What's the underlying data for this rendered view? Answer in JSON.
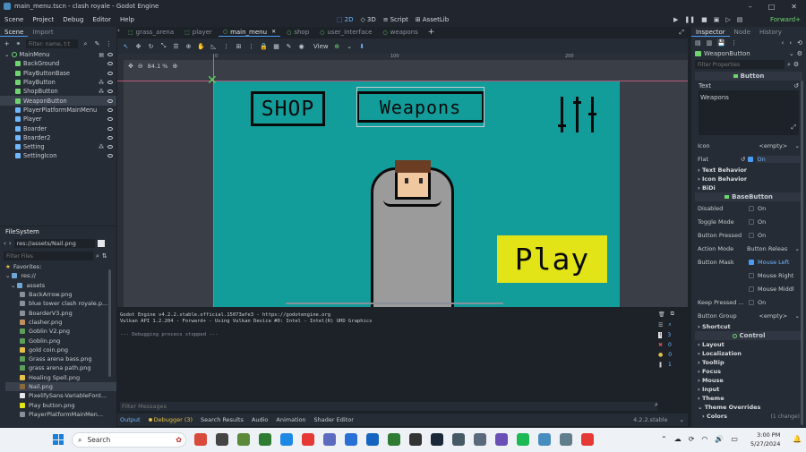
{
  "window": {
    "title": "main_menu.tscn - clash royale - Godot Engine"
  },
  "menu": [
    "Scene",
    "Project",
    "Debug",
    "Editor",
    "Help"
  ],
  "modes": {
    "m2d": "2D",
    "m3d": "3D",
    "script": "Script",
    "assetlib": "AssetLib"
  },
  "renderer": "Forward+",
  "scene_panel": {
    "tabs": [
      "Scene",
      "Import"
    ],
    "filter_placeholder": "Filter: name, t:t",
    "nodes": [
      "MainMenu",
      "BackGround",
      "PlayButtonBase",
      "PlayButton",
      "ShopButton",
      "WeaponButton",
      "PlayerPlatformMainMenu",
      "Player",
      "Boarder",
      "Boarder2",
      "Setting",
      "SettingIcon"
    ]
  },
  "filesystem": {
    "title": "FileSystem",
    "path": "res://assets/Nail.png",
    "filter_placeholder": "Filter Files",
    "favorites": "Favorites:",
    "root": "res://",
    "folder": "assets",
    "files": [
      "BackArrow.png",
      "blue tower clash royale.p...",
      "BoarderV3.png",
      "clasher.png",
      "Goblin V2.png",
      "Goblin.png",
      "gold coin.png",
      "Grass arena bass.png",
      "grass arena path.png",
      "Healing Spell.png",
      "Nail.png",
      "PixelifySans-VariableFont...",
      "Play button.png",
      "PlayerPlatformMainMen..."
    ]
  },
  "editor_tabs": [
    "grass_arena",
    "player",
    "main_menu",
    "shop",
    "user_interface",
    "weapons"
  ],
  "viewport": {
    "zoom": "84.1 %",
    "view_label": "View",
    "ruler_labels": [
      "0",
      "100",
      "200"
    ],
    "buttons": {
      "shop": "SHOP",
      "weapons": "Weapons",
      "play": "Play"
    }
  },
  "console": {
    "lines": [
      "Godot Engine v4.2.2.stable.official.15073afe3 - https://godotengine.org",
      "Vulkan API 1.2.204 - Forward+ - Using Vulkan Device #0: Intel - Intel(R) UHD Graphics",
      "",
      "--- Debugging process stopped ---"
    ],
    "filter_placeholder": "Filter Messages",
    "counts": [
      "3",
      "0",
      "0",
      "1"
    ]
  },
  "bottom_tabs": {
    "output": "Output",
    "debugger": "Debugger (3)",
    "search": "Search Results",
    "audio": "Audio",
    "animation": "Animation",
    "shader": "Shader Editor",
    "version": "4.2.2.stable"
  },
  "inspector": {
    "tabs": [
      "Inspector",
      "Node",
      "History"
    ],
    "node": "WeaponButton",
    "filter_placeholder": "Filter Properties",
    "button_section": "Button",
    "text_label": "Text",
    "text_value": "Weapons",
    "icon_label": "Icon",
    "icon_value": "<empty>",
    "flat_label": "Flat",
    "flat_value": "On",
    "text_behavior": "Text Behavior",
    "icon_behavior": "Icon Behavior",
    "bidi": "BiDi",
    "base_button": "BaseButton",
    "disabled": "Disabled",
    "toggle": "Toggle Mode",
    "pressed": "Button Pressed",
    "action_mode": "Action Mode",
    "action_value": "Button Releas",
    "mask": "Button Mask",
    "mask_left": "Mouse Left",
    "mask_right": "Mouse Right",
    "mask_middle": "Mouse Middl",
    "keep": "Keep Pressed ...",
    "group": "Button Group",
    "group_value": "<empty>",
    "shortcut": "Shortcut",
    "control": "Control",
    "layout": "Layout",
    "localization": "Localization",
    "tooltip": "Tooltip",
    "focus": "Focus",
    "mouse": "Mouse",
    "input": "Input",
    "theme": "Theme",
    "theme_over": "Theme Overrides",
    "colors": "Colors",
    "change": "(1 change)",
    "on": "On"
  },
  "taskbar": {
    "search": "Search",
    "time": "3:00 PM",
    "date": "5/27/2024"
  }
}
